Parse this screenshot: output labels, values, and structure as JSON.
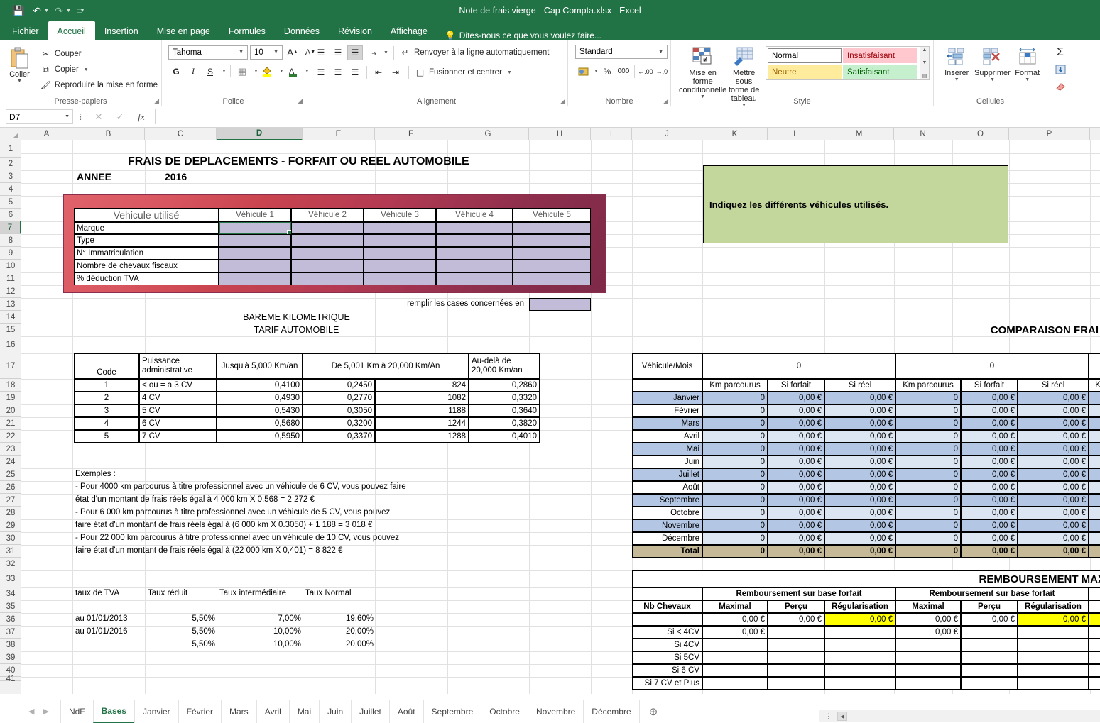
{
  "window": {
    "title": "Note de frais vierge - Cap Compta.xlsx - Excel",
    "qat": [
      {
        "name": "save-icon",
        "glyph": "💾"
      },
      {
        "name": "undo-icon",
        "glyph": "↶"
      },
      {
        "name": "redo-icon",
        "glyph": "↷"
      },
      {
        "name": "customize-qat-icon",
        "glyph": "☰"
      }
    ]
  },
  "ribbon": {
    "tabs": [
      {
        "label": "Fichier",
        "active": false
      },
      {
        "label": "Accueil",
        "active": true
      },
      {
        "label": "Insertion",
        "active": false
      },
      {
        "label": "Mise en page",
        "active": false
      },
      {
        "label": "Formules",
        "active": false
      },
      {
        "label": "Données",
        "active": false
      },
      {
        "label": "Révision",
        "active": false
      },
      {
        "label": "Affichage",
        "active": false
      }
    ],
    "tellme": "Dites-nous ce que vous voulez faire...",
    "groups": {
      "clipboard": {
        "label": "Presse-papiers",
        "paste": "Coller",
        "items": [
          {
            "label": "Couper",
            "icon": "scissors-icon",
            "glyph": "✂"
          },
          {
            "label": "Copier",
            "icon": "copy-icon",
            "glyph": "⧉"
          },
          {
            "label": "Reproduire la mise en forme",
            "icon": "format-painter-icon",
            "glyph": "🖌"
          }
        ]
      },
      "font": {
        "label": "Police",
        "family": "Tahoma",
        "size": "10",
        "buttons": [
          "grow-font",
          "shrink-font",
          "bold",
          "italic",
          "underline",
          "borders",
          "fill-color",
          "font-color"
        ],
        "bold_label": "G",
        "italic_label": "I",
        "underline_label": "S"
      },
      "alignment": {
        "label": "Alignement",
        "wrap": "Renvoyer à la ligne automatiquement",
        "merge": "Fusionner et centrer"
      },
      "number": {
        "label": "Nombre",
        "format": "Standard",
        "percent": "%",
        "thousands": "000"
      },
      "styles": {
        "label": "Style",
        "conditional": "Mise en forme conditionnelle",
        "table": "Mettre sous forme de tableau",
        "cells": [
          "Normal",
          "Insatisfaisant",
          "Neutre",
          "Satisfaisant"
        ]
      },
      "cells": {
        "label": "Cellules",
        "items": [
          "Insérer",
          "Supprimer",
          "Format"
        ]
      }
    }
  },
  "formula_bar": {
    "name_box": "D7",
    "cancel_icon": "cancel-icon",
    "confirm_icon": "confirm-icon",
    "fx_icon": "fx-icon",
    "value": ""
  },
  "grid": {
    "columns": [
      "A",
      "B",
      "C",
      "D",
      "E",
      "F",
      "G",
      "H",
      "I",
      "J",
      "K",
      "L",
      "M",
      "N",
      "O",
      "P"
    ],
    "selected_column": "D",
    "selected_row": 7,
    "rows": [
      1,
      2,
      3,
      4,
      5,
      6,
      7,
      8,
      9,
      10,
      11,
      12,
      13,
      14,
      15,
      16,
      17,
      18,
      19,
      20,
      21,
      22,
      23,
      24,
      25,
      26,
      27,
      28,
      29,
      30,
      31,
      32,
      33,
      34,
      35,
      36,
      37,
      38,
      39,
      40,
      41
    ]
  },
  "sheet": {
    "title": "FRAIS DE DEPLACEMENTS - FORFAIT OU REEL  AUTOMOBILE",
    "year_label": "ANNEE",
    "year_value": "2016",
    "note_green": "Indiquez les différents véhicules utilisés.",
    "fill_hint": "remplir les cases concernées en",
    "vehicle_table": {
      "header": "Vehicule utilisé",
      "columns": [
        "Véhicule 1",
        "Véhicule 2",
        "Véhicule 3",
        "Véhicule 4",
        "Véhicule 5"
      ],
      "rows": [
        "Marque",
        "Type",
        "N° Immatriculation",
        "Nombre de chevaux fiscaux",
        "% déduction TVA"
      ]
    },
    "bareme": {
      "title1": "BAREME KILOMETRIQUE",
      "title2": "TARIF AUTOMOBILE",
      "headers": [
        "Code",
        "Puissance administrative",
        "Jusqu'à 5,000 Km/an",
        "De 5,001 Km à 20,000 Km/An",
        "",
        "Au-delà de 20,000 Km/an"
      ],
      "rows": [
        {
          "code": "1",
          "cv": "< ou = a 3 CV",
          "jusqua": "0,4100",
          "de5001a": "0,2450",
          "fixe": "824",
          "audela": "0,2860"
        },
        {
          "code": "2",
          "cv": "4 CV",
          "jusqua": "0,4930",
          "de5001a": "0,2770",
          "fixe": "1082",
          "audela": "0,3320"
        },
        {
          "code": "3",
          "cv": "5 CV",
          "jusqua": "0,5430",
          "de5001a": "0,3050",
          "fixe": "1188",
          "audela": "0,3640"
        },
        {
          "code": "4",
          "cv": "6 CV",
          "jusqua": "0,5680",
          "de5001a": "0,3200",
          "fixe": "1244",
          "audela": "0,3820"
        },
        {
          "code": "5",
          "cv": "7 CV",
          "jusqua": "0,5950",
          "de5001a": "0,3370",
          "fixe": "1288",
          "audela": "0,4010"
        }
      ]
    },
    "examples": {
      "title": "Exemples :",
      "lines": [
        "- Pour 4000 km parcourus à titre professionnel avec un véhicule de 6 CV, vous pouvez faire",
        "état d'un montant de frais réels égal à 4 000 km X 0.568 = 2 272 €",
        "- Pour 6 000 km parcourus à titre professionnel avec un véhicule de 5 CV, vous pouvez",
        "faire état d'un montant de frais réels égal à (6 000 km X 0.3050) + 1 188 = 3 018 €",
        "- Pour 22 000 km parcourus à titre professionnel avec un véhicule de 10 CV, vous pouvez",
        "faire état d'un montant de frais réels égal à (22 000 km X 0,401) = 8 822 €"
      ]
    },
    "tva": {
      "headers": [
        "taux de TVA",
        "Taux réduit",
        "Taux intermédiaire",
        "Taux Normal"
      ],
      "rows": [
        {
          "date": "au 01/01/2013",
          "reduit": "5,50%",
          "inter": "7,00%",
          "normal": "19,60%"
        },
        {
          "date": "au 01/01/2016",
          "reduit": "5,50%",
          "inter": "10,00%",
          "normal": "20,00%"
        },
        {
          "date": "",
          "reduit": "5,50%",
          "inter": "10,00%",
          "normal": "20,00%"
        }
      ]
    },
    "comparaison": {
      "title": "COMPARAISON FRAI",
      "corner": "Véhicule/Mois",
      "vehicle_headers": [
        "0",
        "0"
      ],
      "sub_headers": [
        "Km parcourus",
        "Si forfait",
        "Si réel"
      ],
      "partial_header": "Kr",
      "months": [
        "Janvier",
        "Février",
        "Mars",
        "Avril",
        "Mai",
        "Juin",
        "Juillet",
        "Août",
        "Septembre",
        "Octobre",
        "Novembre",
        "Décembre"
      ],
      "total_label": "Total",
      "km_value": "0",
      "money_value": "0,00 €"
    },
    "remboursement": {
      "title": "REMBOURSEMENT MAX",
      "group_header": "Remboursement sur base forfait",
      "col_header": "Nb Chevaux",
      "sub_headers": [
        "Maximal",
        "Perçu",
        "Régularisation"
      ],
      "first_row": {
        "maximal": "0,00 €",
        "percu": "0,00 €",
        "regul": "0,00 €"
      },
      "rows": [
        {
          "label": "Si < 4CV",
          "maximal": "0,00 €"
        },
        {
          "label": "Si 4CV",
          "maximal": ""
        },
        {
          "label": "Si 5CV",
          "maximal": ""
        },
        {
          "label": "Si 6 CV",
          "maximal": ""
        },
        {
          "label": "Si 7 CV et Plus",
          "maximal": ""
        }
      ]
    }
  },
  "sheet_tabs": {
    "nav_prev": "◀",
    "nav_next": "▶",
    "tabs": [
      {
        "label": "NdF",
        "active": false
      },
      {
        "label": "Bases",
        "active": true
      },
      {
        "label": "Janvier",
        "active": false
      },
      {
        "label": "Février",
        "active": false
      },
      {
        "label": "Mars",
        "active": false
      },
      {
        "label": "Avril",
        "active": false
      },
      {
        "label": "Mai",
        "active": false
      },
      {
        "label": "Juin",
        "active": false
      },
      {
        "label": "Juillet",
        "active": false
      },
      {
        "label": "Août",
        "active": false
      },
      {
        "label": "Septembre",
        "active": false
      },
      {
        "label": "Octobre",
        "active": false
      },
      {
        "label": "Novembre",
        "active": false
      },
      {
        "label": "Décembre",
        "active": false
      }
    ],
    "add_label": "⊕"
  },
  "colors": {
    "brand": "#217346",
    "banner_red": "#c9444f",
    "note_green": "#c3d69b",
    "vehicle_fill": "#c3bcd8",
    "row_blue_dark": "#b3c6e3",
    "row_blue_light": "#dce6f2",
    "total_tan": "#c5b998",
    "highlight_yellow": "#ffff00"
  }
}
